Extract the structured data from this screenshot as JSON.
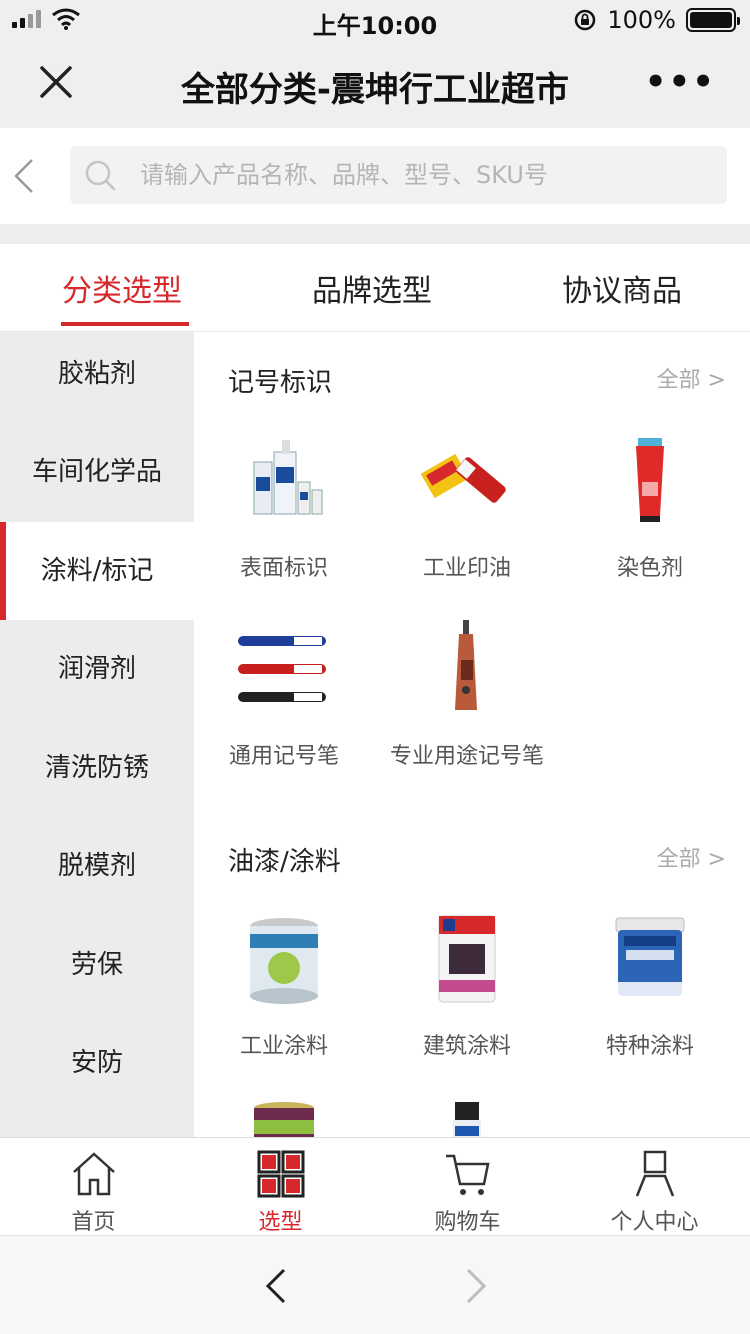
{
  "status_bar": {
    "time": "上午10:00",
    "battery": "100%"
  },
  "header": {
    "title": "全部分类-震坤行工业超市",
    "more": "•••"
  },
  "search": {
    "placeholder": "请输入产品名称、品牌、型号、SKU号"
  },
  "tabs": [
    {
      "label": "分类选型",
      "active": true
    },
    {
      "label": "品牌选型",
      "active": false
    },
    {
      "label": "协议商品",
      "active": false
    }
  ],
  "sidebar": {
    "items": [
      {
        "label": "胶粘剂"
      },
      {
        "label": "车间化学品"
      },
      {
        "label": "涂料/标记",
        "active": true
      },
      {
        "label": "润滑剂"
      },
      {
        "label": "清洗防锈"
      },
      {
        "label": "脱模剂"
      },
      {
        "label": "劳保"
      },
      {
        "label": "安防"
      }
    ]
  },
  "sections": [
    {
      "title": "记号标识",
      "all_label": "全部 >",
      "products": [
        {
          "name": "表面标识",
          "icon": "marking-kit-image"
        },
        {
          "name": "工业印油",
          "icon": "industrial-ink-image"
        },
        {
          "name": "染色剂",
          "icon": "dye-tube-image"
        },
        {
          "name": "通用记号笔",
          "icon": "marker-pens-image"
        },
        {
          "name": "专业用途记号笔",
          "icon": "paint-marker-image"
        }
      ]
    },
    {
      "title": "油漆/涂料",
      "all_label": "全部 >",
      "products": [
        {
          "name": "工业涂料",
          "icon": "paint-can-image"
        },
        {
          "name": "建筑涂料",
          "icon": "nippon-paint-image"
        },
        {
          "name": "特种涂料",
          "icon": "vastsky-bucket-image"
        }
      ]
    }
  ],
  "bottom_nav": [
    {
      "label": "首页",
      "icon": "home-icon"
    },
    {
      "label": "选型",
      "icon": "grid-icon",
      "active": true
    },
    {
      "label": "购物车",
      "icon": "cart-icon"
    },
    {
      "label": "个人中心",
      "icon": "user-icon"
    }
  ],
  "colors": {
    "accent": "#d7292b",
    "sidebar_bg": "#ececec"
  }
}
